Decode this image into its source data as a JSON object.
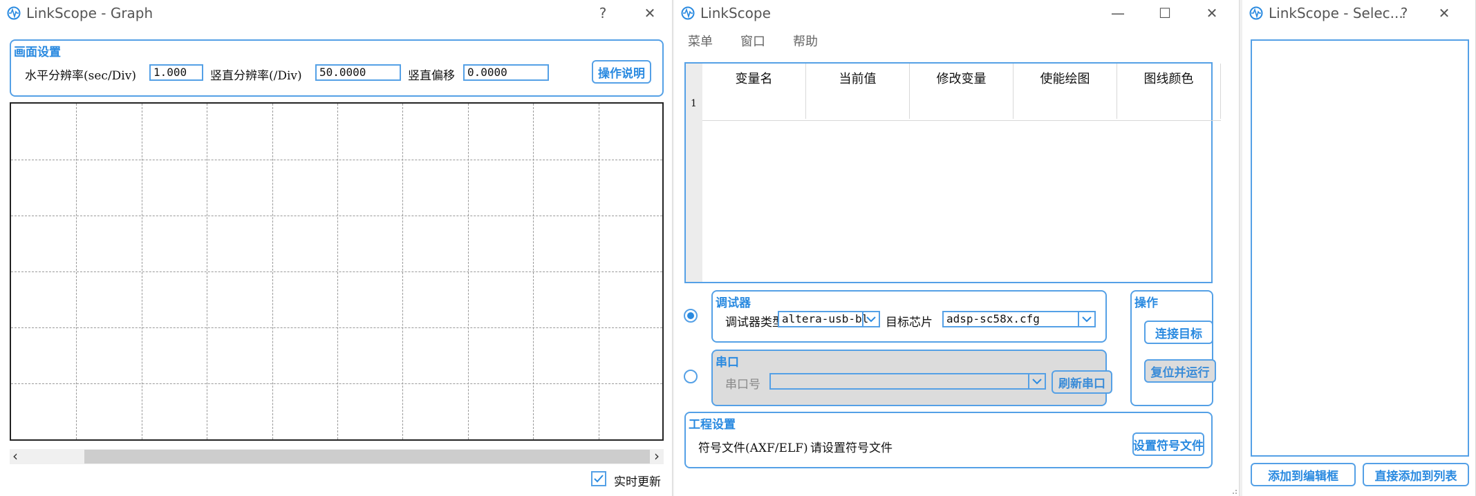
{
  "graph_window": {
    "title": "LinkScope - Graph",
    "help_glyph": "?",
    "close_glyph": "✕",
    "screen_settings": {
      "title": "画面设置",
      "h_res_label": "水平分辨率(sec/Div)",
      "h_res_value": "1.000",
      "v_res_label": "竖直分辨率(/Div)",
      "v_res_value": "50.0000",
      "v_offset_label": "竖直偏移",
      "v_offset_value": "0.0000",
      "instructions_button": "操作说明"
    },
    "scroll_left": "‹",
    "scroll_right": "›",
    "realtime_label": "实时更新",
    "realtime_checked": true
  },
  "main_window": {
    "title": "LinkScope",
    "minimize_glyph": "—",
    "maximize_glyph": "☐",
    "close_glyph": "✕",
    "menu": [
      "菜单",
      "窗口",
      "帮助"
    ],
    "table": {
      "columns": [
        "变量名",
        "当前值",
        "修改变量",
        "使能绘图",
        "图线颜色"
      ],
      "row_numbers": [
        "1"
      ]
    },
    "debugger": {
      "title": "调试器",
      "selected": true,
      "type_label": "调试器类型",
      "type_value": "altera-usb-bl",
      "chip_label": "目标芯片",
      "chip_value": "adsp-sc58x.cfg"
    },
    "serial": {
      "title": "串口",
      "selected": false,
      "port_label": "串口号",
      "port_value": "",
      "refresh_button": "刷新串口"
    },
    "operations": {
      "title": "操作",
      "connect_button": "连接目标",
      "reset_run_button": "复位并运行"
    },
    "project": {
      "title": "工程设置",
      "symbol_label": "符号文件(AXF/ELF)",
      "symbol_status": "请设置符号文件",
      "set_symbol_button": "设置符号文件"
    }
  },
  "select_window": {
    "title": "LinkScope - Selec...",
    "help_glyph": "?",
    "close_glyph": "✕",
    "add_to_editor_button": "添加到编辑框",
    "add_to_list_button": "直接添加到列表"
  },
  "colors": {
    "accent": "#54a0e6",
    "accent_text": "#2a8ae0"
  }
}
